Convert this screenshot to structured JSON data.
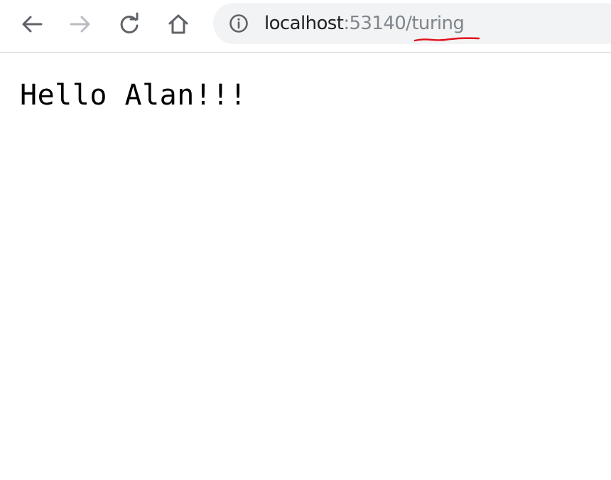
{
  "browser": {
    "url_host": "localhost",
    "url_rest": ":53140/turing",
    "icons": {
      "back": "back-arrow-icon",
      "forward": "forward-arrow-icon",
      "reload": "reload-icon",
      "home": "home-icon",
      "site_info": "info-icon"
    }
  },
  "page": {
    "greeting": "Hello Alan!!!"
  },
  "colors": {
    "omnibox_bg": "#f1f3f4",
    "url_host": "#202124",
    "url_rest": "#80868b",
    "annotation_mark": "#e0101c"
  }
}
